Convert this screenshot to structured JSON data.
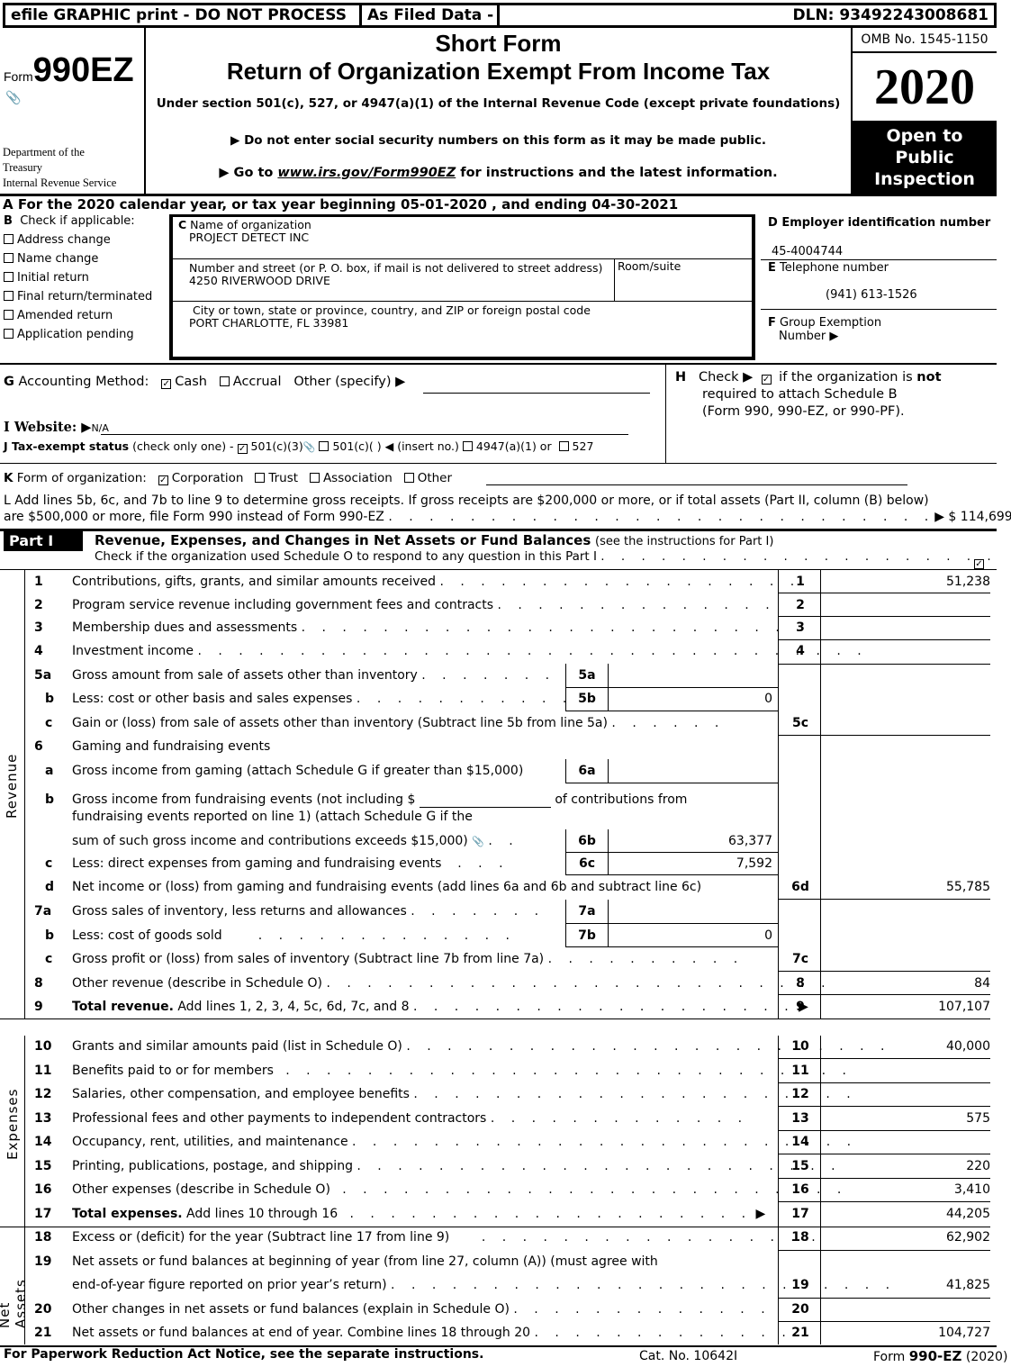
{
  "topbar": {
    "efile": "efile GRAPHIC print - DO NOT PROCESS",
    "filed": "As Filed Data -",
    "dln": "DLN: 93492243008681"
  },
  "header": {
    "form_prefix": "Form",
    "form_number": "990EZ",
    "department": [
      "Department of the",
      "Treasury",
      "Internal Revenue Service"
    ],
    "title_short": "Short Form",
    "title_main": "Return of Organization Exempt From Income Tax",
    "subtitle": "Under section 501(c), 527, or 4947(a)(1) of the Internal Revenue Code (except private foundations)",
    "notice_ssn": "▶ Do not enter social security numbers on this form as it may be made public.",
    "goto_prefix": "▶  Go to ",
    "goto_link": "www.irs.gov/Form990EZ",
    "goto_suffix": " for instructions and the latest information.",
    "omb": "OMB No. 1545-1150",
    "year": "2020",
    "open_public": [
      "Open to",
      "Public",
      "Inspection"
    ]
  },
  "lineA": "A  For the 2020 calendar year, or tax year beginning 05-01-2020 , and ending 04-30-2021",
  "boxB": {
    "label": "Check if applicable:",
    "letter": "B",
    "items": [
      {
        "label": "Address change",
        "checked": false
      },
      {
        "label": "Name change",
        "checked": false
      },
      {
        "label": "Initial return",
        "checked": false
      },
      {
        "label": "Final return/terminated",
        "checked": false
      },
      {
        "label": "Amended return",
        "checked": false
      },
      {
        "label": "Application pending",
        "checked": false
      }
    ]
  },
  "boxC": {
    "name_label": "Name of organization",
    "name_letter": "C",
    "name": "PROJECT DETECT INC",
    "street_label": "Number and street (or P. O. box, if mail is not delivered to street address)",
    "room_label": "Room/suite",
    "street": "4250 RIVERWOOD DRIVE",
    "city_label": "City or town, state or province, country, and ZIP or foreign postal code",
    "city": "PORT CHARLOTTE, FL  33981"
  },
  "boxD": {
    "label": "D Employer identification number",
    "value": "45-4004744"
  },
  "boxE": {
    "letter": "E",
    "label": "Telephone number",
    "value": "(941) 613-1526"
  },
  "boxF": {
    "letter": "F",
    "label": "Group Exemption",
    "label2": "Number  ▶"
  },
  "lineG": {
    "letter": "G",
    "label": "Accounting Method:",
    "cash": "Cash",
    "cash_checked": true,
    "accrual": "Accrual",
    "accrual_checked": false,
    "other": "Other (specify) ▶"
  },
  "lineH": {
    "letter": "H",
    "text1": "Check ▶",
    "checked": true,
    "text2": "if the organization is",
    "bold": "not",
    "text3": "required to attach Schedule B",
    "text4": "(Form 990, 990-EZ, or 990-PF)."
  },
  "lineI": {
    "label": "I Website: ▶",
    "value": "N/A"
  },
  "lineJ": {
    "label": "J Tax-exempt status",
    "note": "(check only one) -",
    "opt1": "501(c)(3)",
    "opt1_checked": true,
    "opt2": "501(c)(  ) ◀ (insert no.)",
    "opt3": "4947(a)(1) or",
    "opt4": "527"
  },
  "lineK": {
    "letter": "K",
    "label": "Form of organization:",
    "options": [
      {
        "label": "Corporation",
        "checked": true
      },
      {
        "label": "Trust",
        "checked": false
      },
      {
        "label": "Association",
        "checked": false
      },
      {
        "label": "Other",
        "checked": false
      }
    ]
  },
  "lineL": {
    "text1": "L Add lines 5b, 6c, and 7b to line 9 to determine gross receipts. If gross receipts are $200,000 or more, or if total assets (Part II, column (B) below)",
    "text2": "are $500,000 or more, file Form 990 instead of Form 990-EZ",
    "value": "▶ $ 114,699"
  },
  "part1": {
    "label": "Part I",
    "title": "Revenue, Expenses, and Changes in Net Assets or Fund Balances",
    "title_note": "(see the instructions for Part I)",
    "schedule_o": "Check if the organization used Schedule O to respond to any question in this Part I",
    "schedule_o_checked": true
  },
  "side_labels": {
    "revenue": "Revenue",
    "expenses": "Expenses",
    "net_assets": "Net Assets"
  },
  "lines": {
    "l1": {
      "num": "1",
      "desc": "Contributions, gifts, grants, and similar amounts received",
      "box": "1",
      "value": "51,238"
    },
    "l2": {
      "num": "2",
      "desc": "Program service revenue including government fees and contracts",
      "box": "2",
      "value": ""
    },
    "l3": {
      "num": "3",
      "desc": "Membership dues and assessments",
      "box": "3",
      "value": ""
    },
    "l4": {
      "num": "4",
      "desc": "Investment income",
      "box": "4",
      "value": ""
    },
    "l5a": {
      "num": "5a",
      "desc": "Gross amount from sale of assets other than inventory",
      "box": "5a",
      "value": ""
    },
    "l5b": {
      "num": "b",
      "desc": "Less: cost or other basis and sales expenses",
      "box": "5b",
      "value": "0"
    },
    "l5c": {
      "num": "c",
      "desc": "Gain or (loss) from sale of assets other than inventory (Subtract line 5b from line 5a)",
      "box": "5c",
      "value": ""
    },
    "l6": {
      "num": "6",
      "desc": "Gaming and fundraising events"
    },
    "l6a": {
      "num": "a",
      "desc": "Gross income from gaming (attach Schedule G if greater than $15,000)",
      "box": "6a",
      "value": ""
    },
    "l6b": {
      "num": "b",
      "desc1": "Gross income from fundraising events (not including $",
      "desc1b": "of contributions from",
      "desc2": "fundraising events reported on line 1) (attach Schedule G if the",
      "desc3": "sum of such gross income and contributions exceeds $15,000)",
      "box": "6b",
      "value": "63,377"
    },
    "l6c": {
      "num": "c",
      "desc": "Less: direct expenses from gaming and fundraising events",
      "box": "6c",
      "value": "7,592"
    },
    "l6d": {
      "num": "d",
      "desc": "Net income or (loss) from gaming and fundraising events (add lines 6a and 6b and subtract line 6c)",
      "box": "6d",
      "value": "55,785"
    },
    "l7a": {
      "num": "7a",
      "desc": "Gross sales of inventory, less returns and allowances",
      "box": "7a",
      "value": ""
    },
    "l7b": {
      "num": "b",
      "desc": "Less: cost of goods sold",
      "box": "7b",
      "value": "0"
    },
    "l7c": {
      "num": "c",
      "desc": "Gross profit or (loss) from sales of inventory (Subtract line 7b from line 7a)",
      "box": "7c",
      "value": ""
    },
    "l8": {
      "num": "8",
      "desc": "Other revenue (describe in Schedule O)",
      "box": "8",
      "value": "84"
    },
    "l9": {
      "num": "9",
      "desc_bold": "Total revenue.",
      "desc": " Add lines 1, 2, 3, 4, 5c, 6d, 7c, and 8",
      "box": "9",
      "value": "107,107"
    },
    "l10": {
      "num": "10",
      "desc": "Grants and similar amounts paid (list in Schedule O)",
      "box": "10",
      "value": "40,000"
    },
    "l11": {
      "num": "11",
      "desc": "Benefits paid to or for members",
      "box": "11",
      "value": ""
    },
    "l12": {
      "num": "12",
      "desc": "Salaries, other compensation, and employee benefits",
      "box": "12",
      "value": ""
    },
    "l13": {
      "num": "13",
      "desc": "Professional fees and other payments to independent contractors",
      "box": "13",
      "value": "575"
    },
    "l14": {
      "num": "14",
      "desc": "Occupancy, rent, utilities, and maintenance",
      "box": "14",
      "value": ""
    },
    "l15": {
      "num": "15",
      "desc": "Printing, publications, postage, and shipping",
      "box": "15",
      "value": "220"
    },
    "l16": {
      "num": "16",
      "desc": "Other expenses (describe in Schedule O)",
      "box": "16",
      "value": "3,410"
    },
    "l17": {
      "num": "17",
      "desc_bold": "Total expenses.",
      "desc": " Add lines 10 through 16",
      "box": "17",
      "value": "44,205"
    },
    "l18": {
      "num": "18",
      "desc": "Excess or (deficit) for the year (Subtract line 17 from line 9)",
      "box": "18",
      "value": "62,902"
    },
    "l19": {
      "num": "19",
      "desc1": "Net assets or fund balances at beginning of year (from line 27, column (A)) (must agree with",
      "desc2": "end-of-year figure reported on prior year’s return)",
      "box": "19",
      "value": "41,825"
    },
    "l20": {
      "num": "20",
      "desc": "Other changes in net assets or fund balances (explain in Schedule O)",
      "box": "20",
      "value": ""
    },
    "l21": {
      "num": "21",
      "desc": "Net assets or fund balances at end of year. Combine lines 18 through 20",
      "box": "21",
      "value": "104,727"
    }
  },
  "footer": {
    "paperwork": "For Paperwork Reduction Act Notice, see the separate instructions.",
    "cat": "Cat. No. 10642I",
    "form_prefix": "Form",
    "form_bold": "990-EZ",
    "form_year": "(2020)"
  }
}
